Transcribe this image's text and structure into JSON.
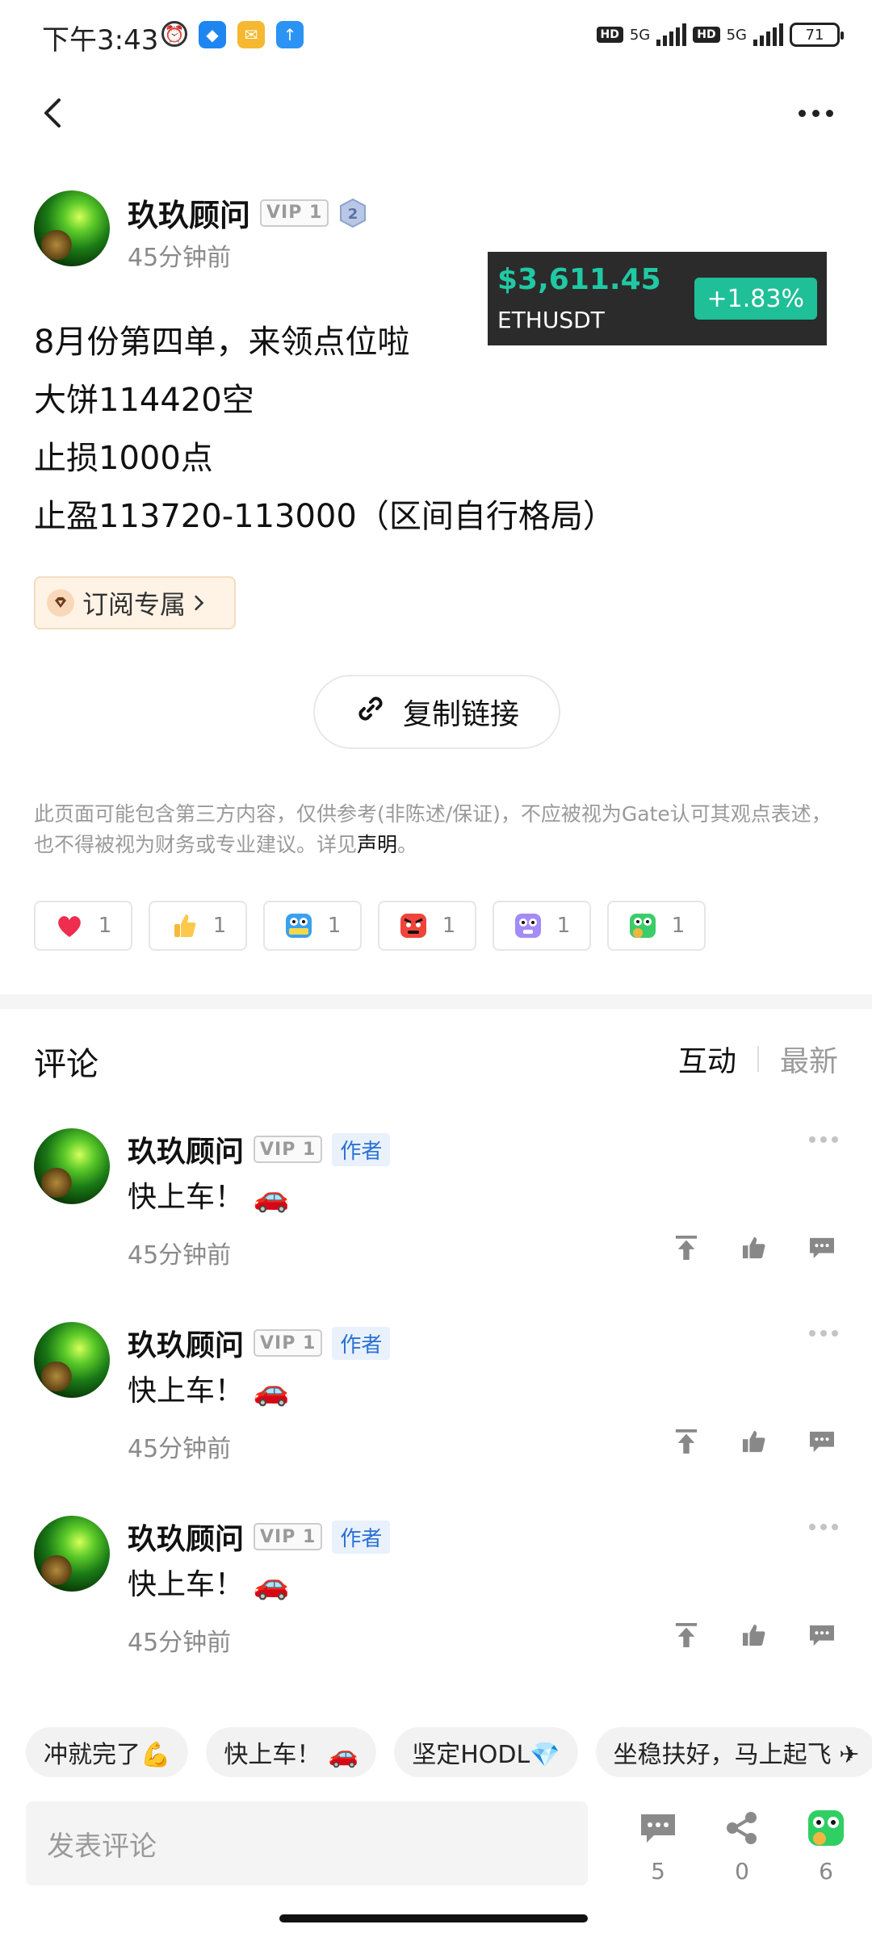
{
  "status_bar": {
    "time": "下午3:43",
    "network_1": "5G",
    "network_2": "5G",
    "hd_1": "HD",
    "hd_2": "HD",
    "battery": "71"
  },
  "post": {
    "author": "玖玖顾问",
    "vip": "VIP 1",
    "level": "2",
    "time": "45分钟前",
    "lines": [
      "8月份第四单，来领点位啦",
      "大饼114420空",
      "止损1000点",
      "止盈113720-113000（区间自行格局）"
    ],
    "subscribe_label": "订阅专属",
    "copy_link_label": "复制链接",
    "disclaimer_text": "此页面可能包含第三方内容，仅供参考(非陈述/保证)，不应被视为Gate认可其观点表述，也不得被视为财务或专业建议。详见",
    "disclaimer_link": "声明",
    "disclaimer_end": "。"
  },
  "ticker": {
    "price": "$3,611.45",
    "symbol": "ETHUSDT",
    "change": "+1.83%"
  },
  "reactions": [
    {
      "icon": "heart",
      "count": "1"
    },
    {
      "icon": "thumbs-up",
      "count": "1"
    },
    {
      "icon": "hodl",
      "count": "1"
    },
    {
      "icon": "angry",
      "count": "1"
    },
    {
      "icon": "ghost",
      "count": "1"
    },
    {
      "icon": "sick",
      "count": "1"
    }
  ],
  "comments_section": {
    "title": "评论",
    "tab_interact": "互动",
    "tab_latest": "最新",
    "items": [
      {
        "author": "玖玖顾问",
        "vip": "VIP 1",
        "badge": "作者",
        "text": "快上车！ 🚗",
        "time": "45分钟前"
      },
      {
        "author": "玖玖顾问",
        "vip": "VIP 1",
        "badge": "作者",
        "text": "快上车！ 🚗",
        "time": "45分钟前"
      },
      {
        "author": "玖玖顾问",
        "vip": "VIP 1",
        "badge": "作者",
        "text": "快上车！ 🚗",
        "time": "45分钟前"
      }
    ]
  },
  "quick_replies": [
    "冲就完了💪",
    "快上车！ 🚗",
    "坚定HODL💎",
    "坐稳扶好，马上起飞 ✈"
  ],
  "composer": {
    "placeholder": "发表评论",
    "comment_count": "5",
    "share_count": "0",
    "reaction_count": "6"
  },
  "colors": {
    "accent_green": "#20c9a4",
    "change_badge": "#1fbf97",
    "ticker_bg": "#2b2b2b",
    "author_badge": "#2a72d4"
  }
}
